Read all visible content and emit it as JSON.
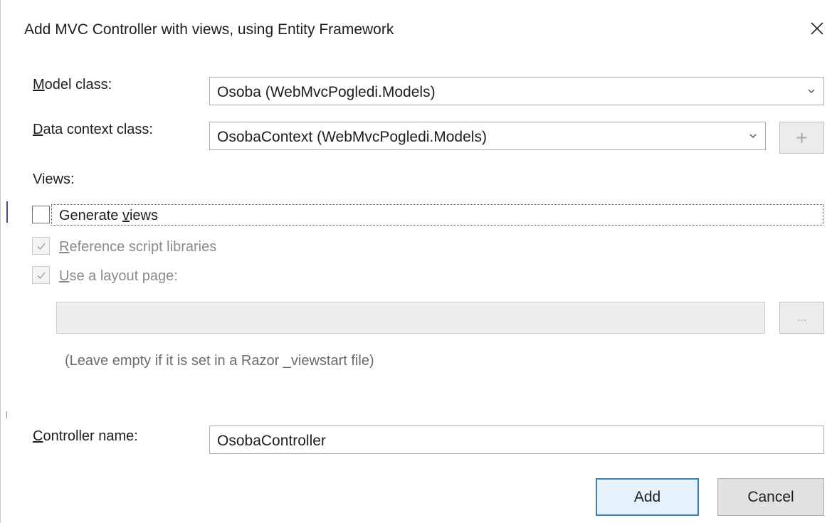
{
  "dialog": {
    "title": "Add MVC Controller with views, using Entity Framework"
  },
  "model_class": {
    "label_accel": "M",
    "label_rest": "odel class:",
    "value": "Osoba (WebMvcPogledi.Models)"
  },
  "data_context": {
    "label_accel": "D",
    "label_rest": "ata context class:",
    "value": "OsobaContext (WebMvcPogledi.Models)",
    "add_label": "+"
  },
  "views": {
    "heading": "Views:",
    "generate_pre": "Generate ",
    "generate_accel": "v",
    "generate_post": "iews",
    "generate_checked": false,
    "reference_accel": "R",
    "reference_rest": "eference script libraries",
    "reference_checked": true,
    "layout_accel": "U",
    "layout_rest": "se a layout page:",
    "layout_checked": true,
    "layout_path_value": "",
    "browse_label": "...",
    "hint": "(Leave empty if it is set in a Razor _viewstart file)"
  },
  "controller": {
    "label_accel": "C",
    "label_rest": "ontroller name:",
    "value": "OsobaController"
  },
  "buttons": {
    "add": "Add",
    "cancel": "Cancel"
  },
  "colors": {
    "accent": "#3c7fb1",
    "disabled_text": "#8a8a8a"
  }
}
